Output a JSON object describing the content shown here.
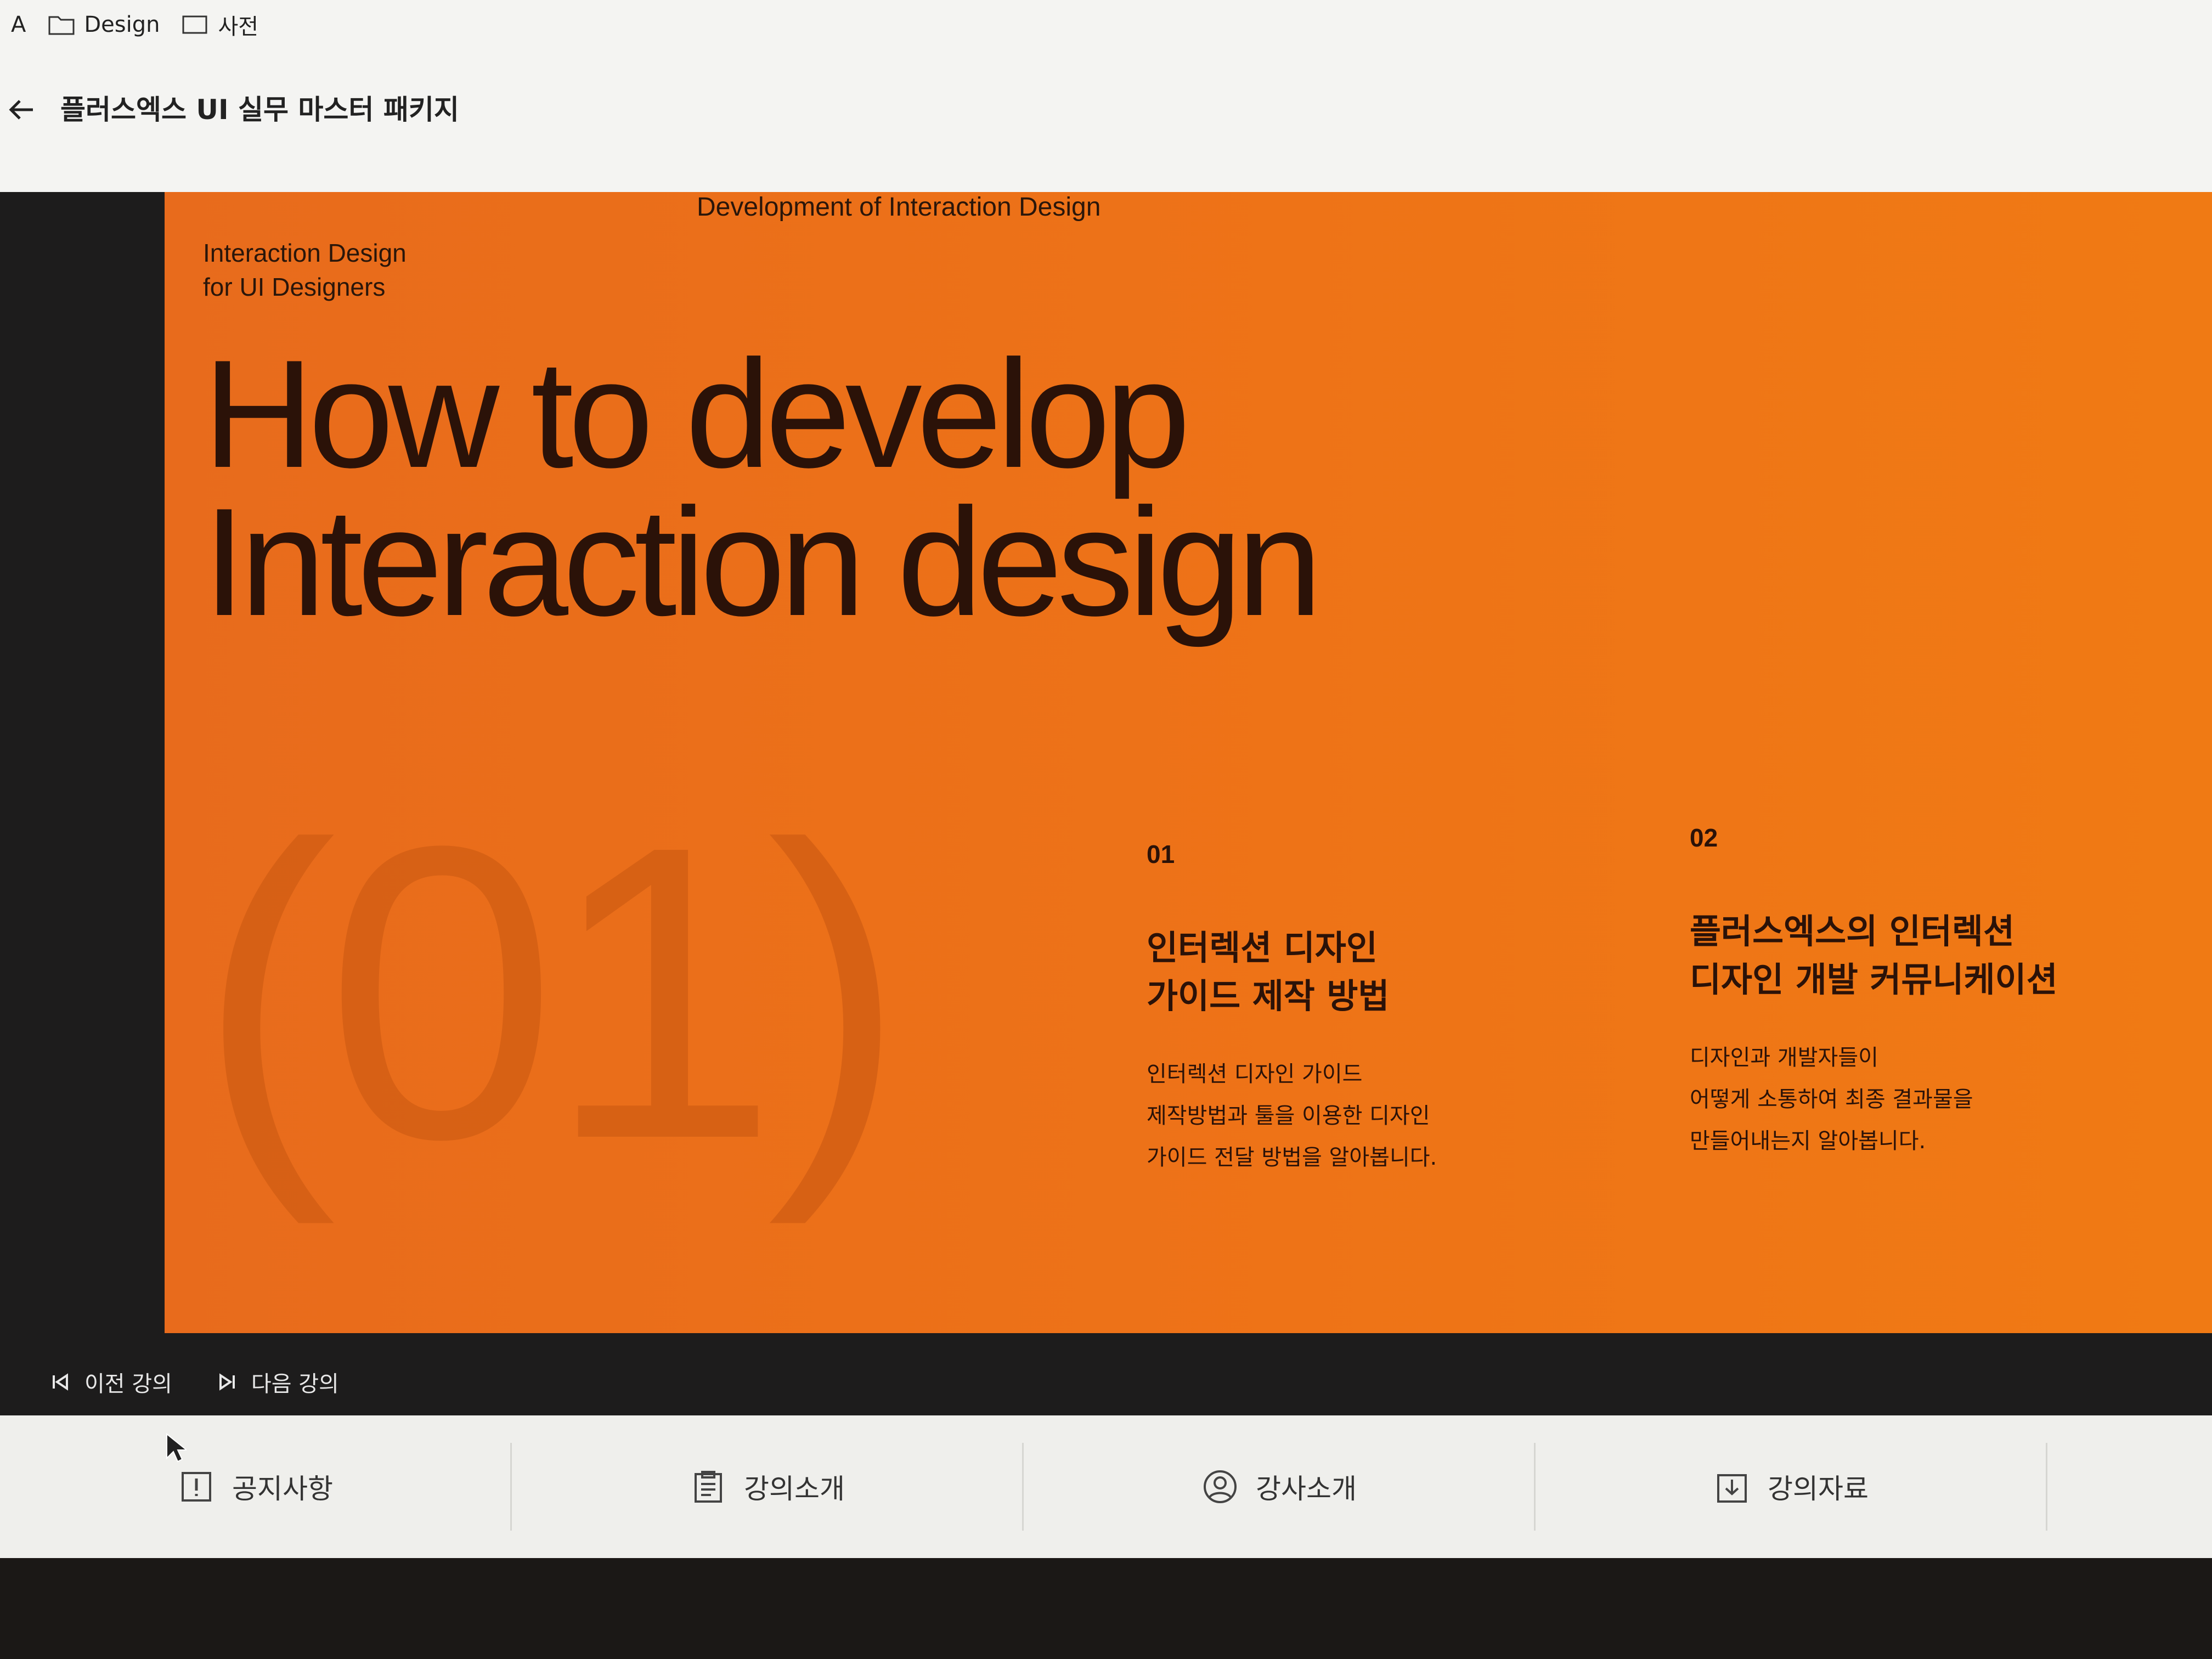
{
  "bookmarks": [
    {
      "label": "A",
      "icon": "folder-icon"
    },
    {
      "label": "Design",
      "icon": "folder-icon"
    },
    {
      "label": "사전",
      "icon": "folder-icon"
    }
  ],
  "header": {
    "course_title": "플러스엑스 UI 실무 마스터 패키지"
  },
  "slide": {
    "eyebrow_left": "Interaction Design\nfor UI Designers",
    "eyebrow_center": "Development of Interaction Design",
    "headline": "How to develop\nInteraction design",
    "big_number": "(01)",
    "columns": [
      {
        "num": "01",
        "title": "인터렉션 디자인\n가이드 제작 방법",
        "desc": "인터렉션 디자인 가이드\n제작방법과 툴을 이용한 디자인\n가이드 전달 방법을 알아봅니다."
      },
      {
        "num": "02",
        "title": "플러스엑스의 인터렉션\n디자인 개발 커뮤니케이션",
        "desc": "디자인과 개발자들이\n어떻게 소통하여 최종 결과물을\n만들어내는지 알아봅니다."
      }
    ]
  },
  "controls": {
    "prev_label": "이전 강의",
    "next_label": "다음 강의"
  },
  "tabs": [
    {
      "label": "공지사항",
      "icon": "notice-icon"
    },
    {
      "label": "강의소개",
      "icon": "clipboard-icon"
    },
    {
      "label": "강사소개",
      "icon": "user-icon"
    },
    {
      "label": "강의자료",
      "icon": "download-icon"
    }
  ],
  "colors": {
    "slide_orange": "#ee7317",
    "slide_text": "#2b1208",
    "player_bg": "#1d1c1c"
  }
}
